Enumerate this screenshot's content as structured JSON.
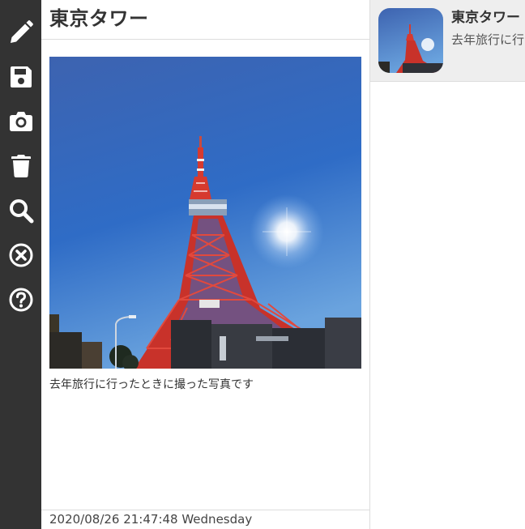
{
  "toolbar": {
    "icons": [
      "pencil-icon",
      "save-icon",
      "camera-icon",
      "trash-icon",
      "search-icon",
      "close-circle-icon",
      "help-icon"
    ],
    "icon_color": "#ffffff",
    "background": "#333333"
  },
  "note": {
    "title": "東京タワー",
    "caption": "去年旅行に行ったときに撮った写真です",
    "timestamp": "2020/08/26 21:47:48 Wednesday"
  },
  "list": {
    "items": [
      {
        "title": "東京タワー",
        "excerpt": "去年旅行に行ったときに撮った写真です",
        "selected": true
      }
    ],
    "selected_background": "#eeeeee"
  },
  "colors": {
    "tower_red": "#d63a2f",
    "sky_blue": "#2f62b8"
  }
}
